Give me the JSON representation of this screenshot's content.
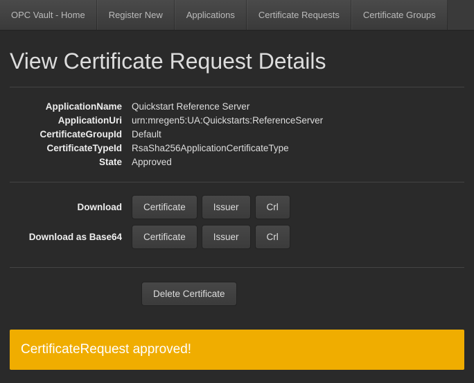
{
  "nav": {
    "home": "OPC Vault - Home",
    "register": "Register New",
    "apps": "Applications",
    "certreq": "Certificate Requests",
    "certgrp": "Certificate Groups"
  },
  "header": {
    "title": "View Certificate Request Details"
  },
  "details": {
    "labels": {
      "appName": "ApplicationName",
      "appUri": "ApplicationUri",
      "certGroup": "CertificateGroupId",
      "certType": "CertificateTypeId",
      "state": "State"
    },
    "values": {
      "appName": "Quickstart Reference Server",
      "appUri": "urn:mregen5:UA:Quickstarts:ReferenceServer",
      "certGroup": "Default",
      "certType": "RsaSha256ApplicationCertificateType",
      "state": "Approved"
    }
  },
  "downloads": {
    "row1_label": "Download",
    "row2_label": "Download as Base64",
    "btn_cert": "Certificate",
    "btn_issuer": "Issuer",
    "btn_crl": "Crl"
  },
  "actions": {
    "delete": "Delete Certificate"
  },
  "alert": {
    "message": "CertificateRequest approved!"
  }
}
